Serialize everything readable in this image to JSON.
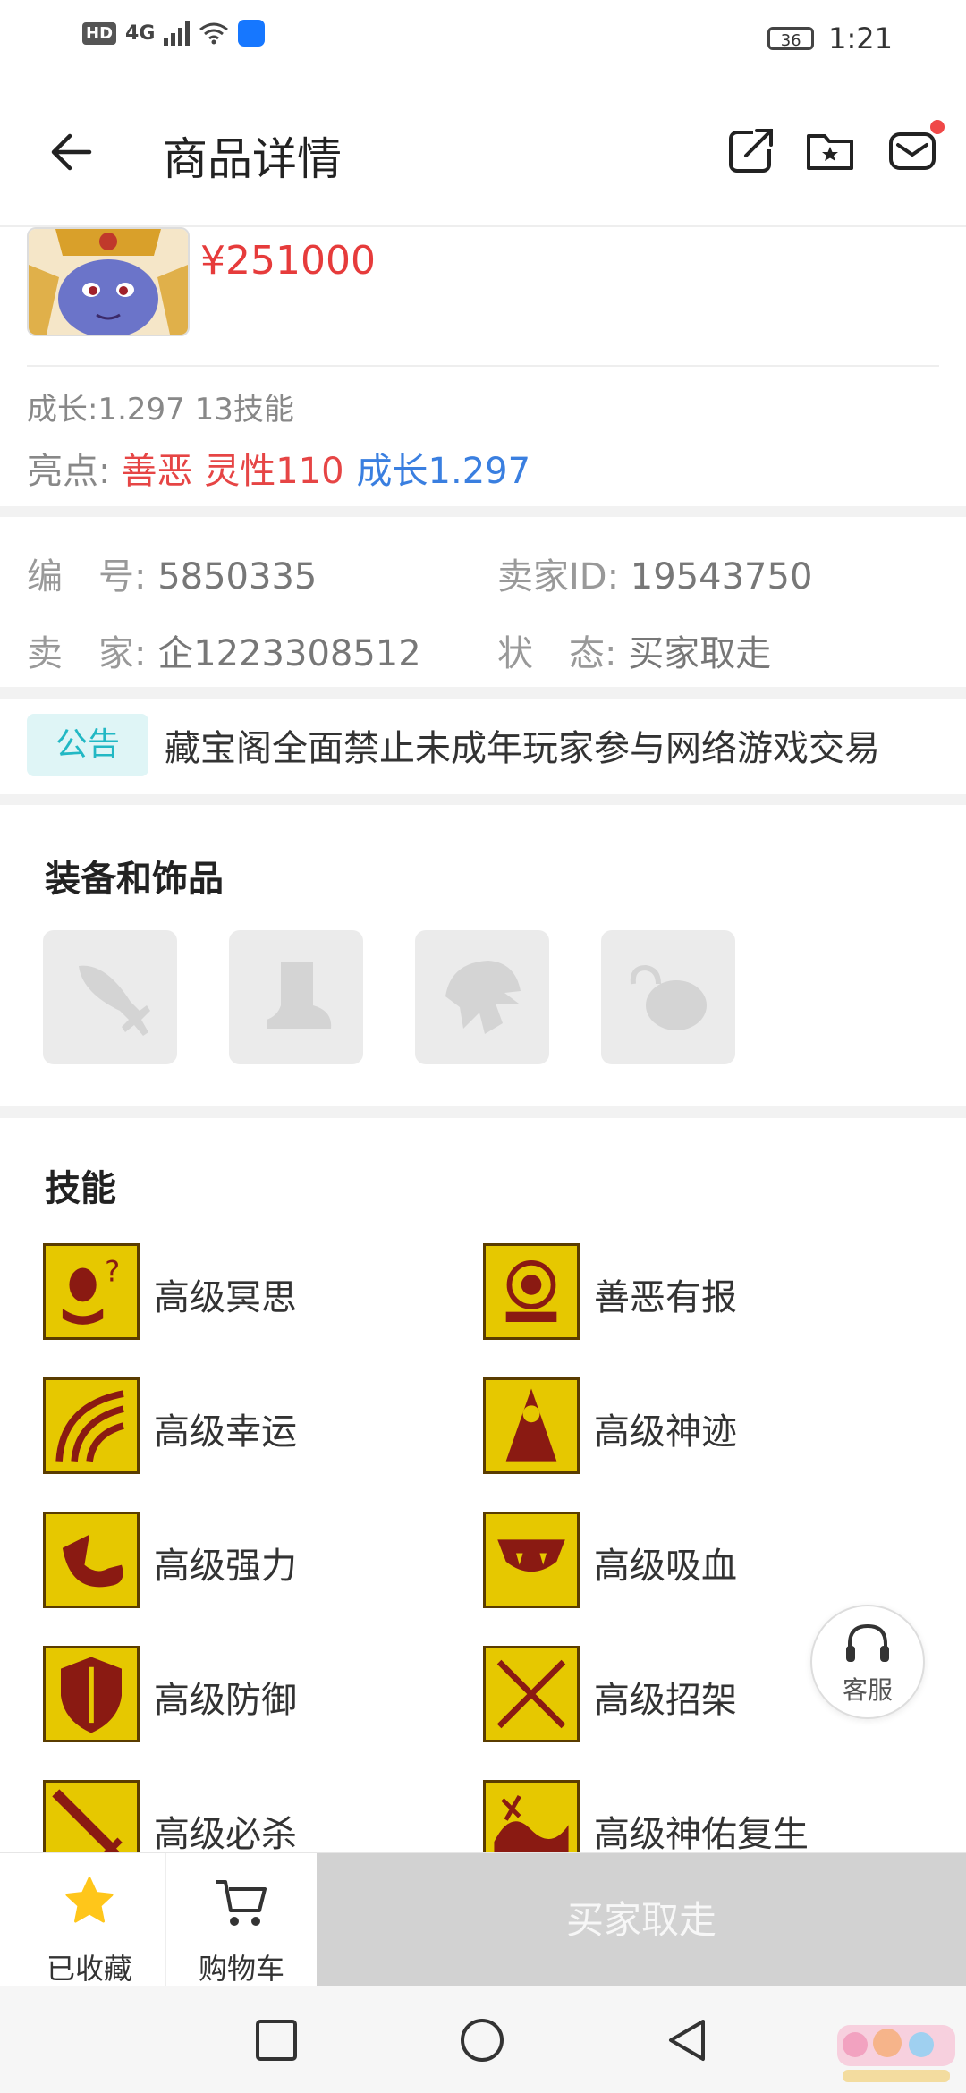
{
  "status_bar": {
    "hd": "HD",
    "network": "4G",
    "battery": "36",
    "time": "1:21"
  },
  "header": {
    "title": "商品详情"
  },
  "product": {
    "price": "¥251000",
    "growth_line": "成长:1.297 13技能",
    "highlight_label": "亮点:",
    "highlight_red": "善恶 灵性110",
    "highlight_blue": "成长1.297"
  },
  "info": {
    "id_label": "编　号:",
    "id_value": "5850335",
    "seller_id_label": "卖家ID:",
    "seller_id_value": "19543750",
    "seller_label": "卖　家:",
    "seller_value": "企1223308512",
    "status_label": "状　态:",
    "status_value": "买家取走"
  },
  "notice": {
    "tag": "公告",
    "text": "藏宝阁全面禁止未成年玩家参与网络游戏交易"
  },
  "equipment": {
    "title": "装备和饰品",
    "slots": [
      "weapon-icon",
      "boot-icon",
      "helmet-icon",
      "amulet-icon"
    ]
  },
  "skills": {
    "title": "技能",
    "items": [
      {
        "name": "高级冥思",
        "icon": "meditation-icon"
      },
      {
        "name": "善恶有报",
        "icon": "karma-icon"
      },
      {
        "name": "高级幸运",
        "icon": "luck-icon"
      },
      {
        "name": "高级神迹",
        "icon": "miracle-icon"
      },
      {
        "name": "高级强力",
        "icon": "strength-icon"
      },
      {
        "name": "高级吸血",
        "icon": "vampire-icon"
      },
      {
        "name": "高级防御",
        "icon": "shield-icon"
      },
      {
        "name": "高级招架",
        "icon": "parry-icon"
      },
      {
        "name": "高级必杀",
        "icon": "sword-icon"
      },
      {
        "name": "高级神佑复生",
        "icon": "revive-icon"
      }
    ]
  },
  "customer_service": {
    "label": "客服"
  },
  "bottom_bar": {
    "favorited_label": "已收藏",
    "cart_label": "购物车",
    "buy_label": "买家取走"
  },
  "colors": {
    "price": "#e63b3b",
    "highlight_red": "#e64545",
    "highlight_blue": "#3a7fe0",
    "notice_tag_bg": "#dff5f6",
    "notice_tag_text": "#22b8c4",
    "star": "#ffc61a",
    "skill_bg": "#e6c800"
  }
}
